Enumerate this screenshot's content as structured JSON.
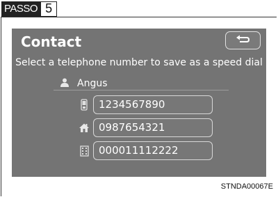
{
  "step": {
    "label": "PASSO",
    "number": "5"
  },
  "screen": {
    "title": "Contact",
    "back_icon": "return-arrow-icon",
    "instruction": "Select a telephone number to save as a speed dial",
    "contact": {
      "name": "Angus",
      "icon": "person-icon"
    },
    "numbers": [
      {
        "icon": "mobile-phone-icon",
        "value": "1234567890"
      },
      {
        "icon": "home-icon",
        "value": "0987654321"
      },
      {
        "icon": "office-building-icon",
        "value": "000011112222"
      }
    ]
  },
  "caption": "STNDA00067E"
}
